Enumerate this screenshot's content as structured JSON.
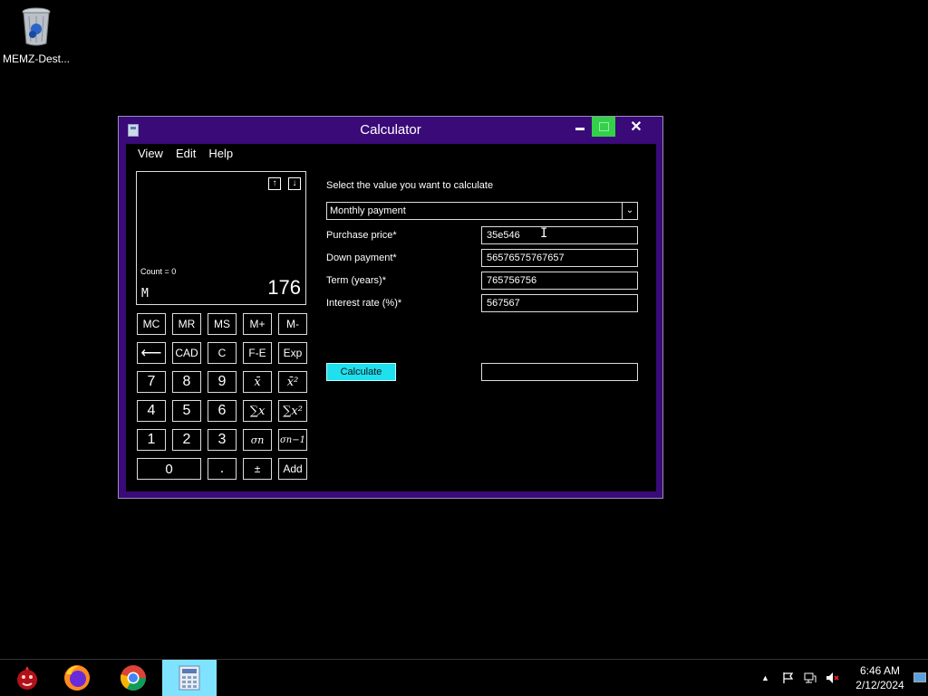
{
  "desktop": {
    "icon_label": "MEMZ-Dest..."
  },
  "window": {
    "title": "Calculator",
    "close_glyph": "✕",
    "menu": [
      "View",
      "Edit",
      "Help"
    ]
  },
  "display": {
    "history_up": "↑",
    "history_down": "↓",
    "count": "Count = 0",
    "memory_indicator": "M",
    "value": "176"
  },
  "keypad": {
    "memory": [
      "MC",
      "MR",
      "MS",
      "M+",
      "M-"
    ],
    "row2": [
      "⟵",
      "CAD",
      "C",
      "F-E",
      "Exp"
    ],
    "row3": [
      "7",
      "8",
      "9",
      "x̄",
      "x̄²"
    ],
    "row4": [
      "4",
      "5",
      "6",
      "∑x",
      "∑x²"
    ],
    "row5": [
      "1",
      "2",
      "3",
      "σn",
      "σn−1"
    ],
    "row6": [
      "0",
      ".",
      "±",
      "Add"
    ]
  },
  "form": {
    "prompt": "Select the value you want to calculate",
    "selected_option": "Monthly payment",
    "dropdown_arrow": "⌄",
    "fields": [
      {
        "label": "Purchase price*",
        "value": "35e546"
      },
      {
        "label": "Down payment*",
        "value": "56576575767657"
      },
      {
        "label": "Term (years)*",
        "value": "765756756"
      },
      {
        "label": "Interest rate (%)*",
        "value": "567567"
      }
    ],
    "calculate_label": "Calculate",
    "result_value": ""
  },
  "taskbar": {
    "time": "6:46 AM",
    "date": "2/12/2024",
    "tray_arrow": "▲"
  },
  "colors": {
    "window_frame": "#3a0a78",
    "calculate_button": "#1fe0ee",
    "maximize_button": "#33d14a",
    "active_taskbar_item": "#7fe3ff"
  }
}
